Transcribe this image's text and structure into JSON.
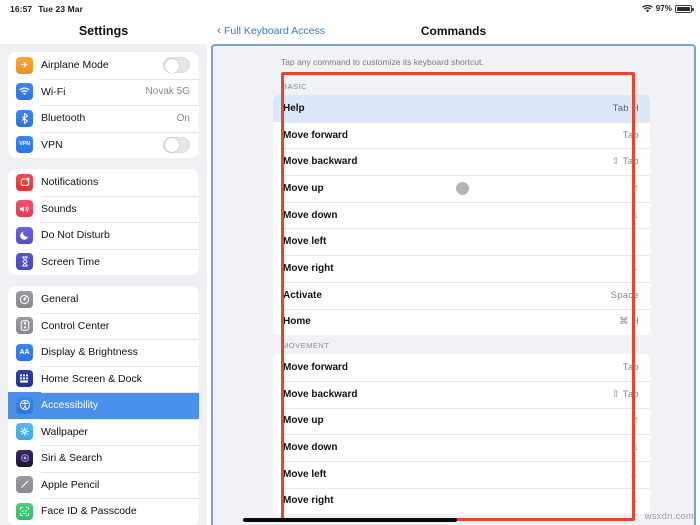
{
  "status_bar": {
    "time": "16:57",
    "date": "Tue 23 Mar",
    "wifi_icon": "wifi-icon",
    "battery_percent": "97%",
    "battery_icon": "battery-icon"
  },
  "sidebar": {
    "title": "Settings",
    "groups": [
      {
        "items": [
          {
            "label": "Airplane Mode",
            "icon": "airplane-icon",
            "control": "toggle",
            "toggle_on": false,
            "value": ""
          },
          {
            "label": "Wi-Fi",
            "icon": "wifi-icon",
            "control": "value",
            "value": "Novak 5G"
          },
          {
            "label": "Bluetooth",
            "icon": "bluetooth-icon",
            "control": "value",
            "value": "On"
          },
          {
            "label": "VPN",
            "icon": "vpn-icon",
            "control": "toggle",
            "toggle_on": false,
            "value": ""
          }
        ]
      },
      {
        "items": [
          {
            "label": "Notifications",
            "icon": "notifications-icon",
            "control": "none",
            "value": ""
          },
          {
            "label": "Sounds",
            "icon": "sounds-icon",
            "control": "none",
            "value": ""
          },
          {
            "label": "Do Not Disturb",
            "icon": "moon-icon",
            "control": "none",
            "value": ""
          },
          {
            "label": "Screen Time",
            "icon": "hourglass-icon",
            "control": "none",
            "value": ""
          }
        ]
      },
      {
        "items": [
          {
            "label": "General",
            "icon": "gear-icon",
            "control": "none",
            "value": ""
          },
          {
            "label": "Control Center",
            "icon": "control-center-icon",
            "control": "none",
            "value": ""
          },
          {
            "label": "Display & Brightness",
            "icon": "display-brightness-icon",
            "control": "none",
            "value": ""
          },
          {
            "label": "Home Screen & Dock",
            "icon": "home-screen-dock-icon",
            "control": "none",
            "value": ""
          },
          {
            "label": "Accessibility",
            "icon": "accessibility-icon",
            "control": "none",
            "value": "",
            "selected": true
          },
          {
            "label": "Wallpaper",
            "icon": "wallpaper-icon",
            "control": "none",
            "value": ""
          },
          {
            "label": "Siri & Search",
            "icon": "siri-icon",
            "control": "none",
            "value": ""
          },
          {
            "label": "Apple Pencil",
            "icon": "apple-pencil-icon",
            "control": "none",
            "value": ""
          },
          {
            "label": "Face ID & Passcode",
            "icon": "face-id-icon",
            "control": "none",
            "value": ""
          }
        ]
      }
    ]
  },
  "detail": {
    "back_label": "Full Keyboard Access",
    "back_icon": "chevron-left-icon",
    "title": "Commands",
    "hint": "Tap any command to customize its keyboard shortcut.",
    "sections": [
      {
        "header": "BASIC",
        "commands": [
          {
            "name": "Help",
            "shortcut": "Tab H",
            "highlighted": true
          },
          {
            "name": "Move forward",
            "shortcut": "Tab"
          },
          {
            "name": "Move backward",
            "shortcut": "⇧ Tab"
          },
          {
            "name": "Move up",
            "shortcut": "↑"
          },
          {
            "name": "Move down",
            "shortcut": "↓"
          },
          {
            "name": "Move left",
            "shortcut": "←"
          },
          {
            "name": "Move right",
            "shortcut": "→"
          },
          {
            "name": "Activate",
            "shortcut": "Space"
          },
          {
            "name": "Home",
            "shortcut": "⌘ H"
          }
        ]
      },
      {
        "header": "MOVEMENT",
        "commands": [
          {
            "name": "Move forward",
            "shortcut": "Tab"
          },
          {
            "name": "Move backward",
            "shortcut": "⇧ Tab"
          },
          {
            "name": "Move up",
            "shortcut": "↑"
          },
          {
            "name": "Move down",
            "shortcut": "↓"
          },
          {
            "name": "Move left",
            "shortcut": "←"
          },
          {
            "name": "Move right",
            "shortcut": "→"
          }
        ]
      }
    ]
  },
  "overlays": {
    "annotation_color": "#e8452c",
    "touch_indicator": "touch-indicator",
    "home_indicator": "home-indicator",
    "watermark": "wsxdn.com"
  },
  "colors": {
    "accent_blue": "#4a90e8",
    "link_blue": "#2f7de1",
    "highlight_row": "#dce8f8",
    "focus_border": "#7aa0d4"
  }
}
